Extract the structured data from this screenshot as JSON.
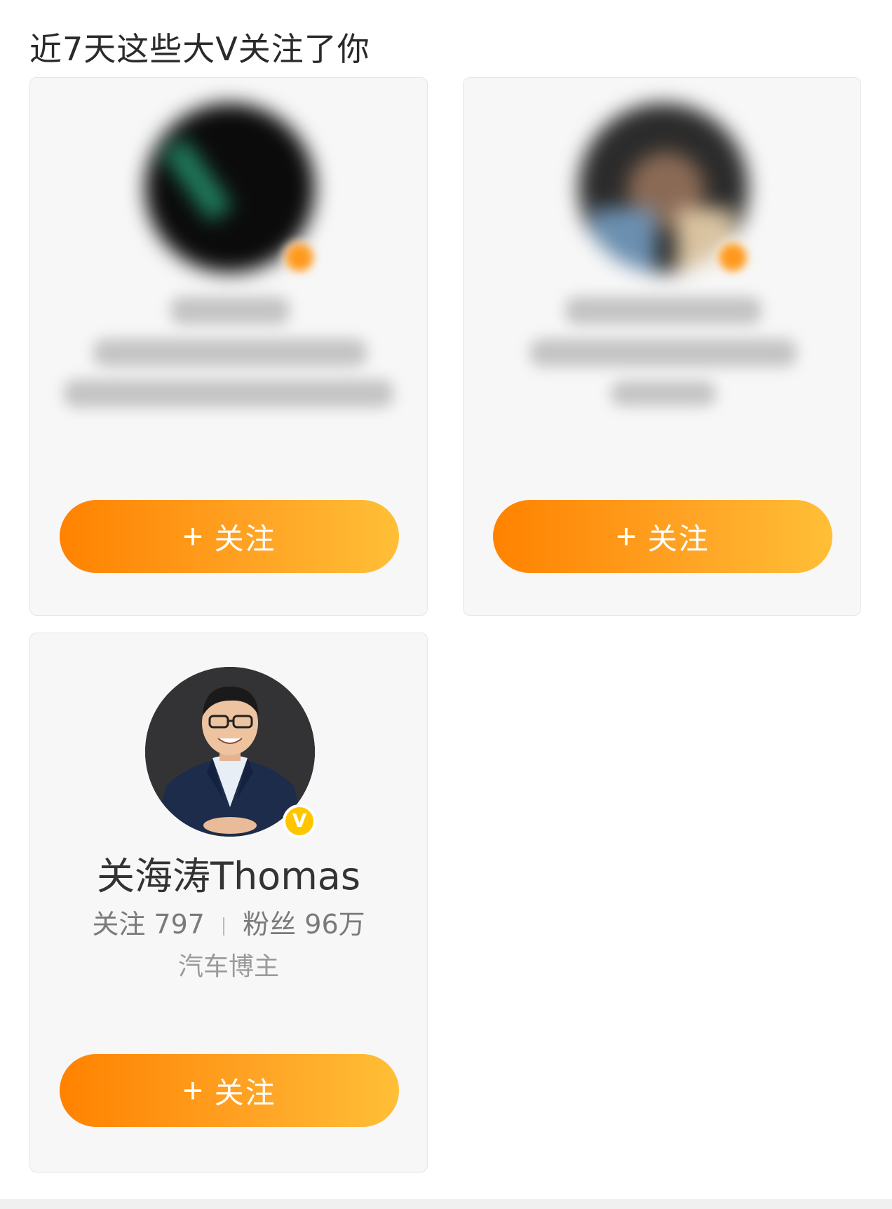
{
  "section": {
    "title": "近7天这些大V关注了你"
  },
  "cards": [
    {
      "follow_plus": "+",
      "follow_label": "关注"
    },
    {
      "follow_plus": "+",
      "follow_label": "关注"
    },
    {
      "name": "关海涛Thomas",
      "following_label": "关注",
      "following_count": "797",
      "followers_label": "粉丝",
      "followers_count": "96万",
      "description": "汽车博主",
      "verified_badge": "V",
      "follow_plus": "+",
      "follow_label": "关注"
    }
  ],
  "colors": {
    "accent_start": "#ff8200",
    "accent_end": "#ffbf36",
    "badge": "#ffc600"
  }
}
